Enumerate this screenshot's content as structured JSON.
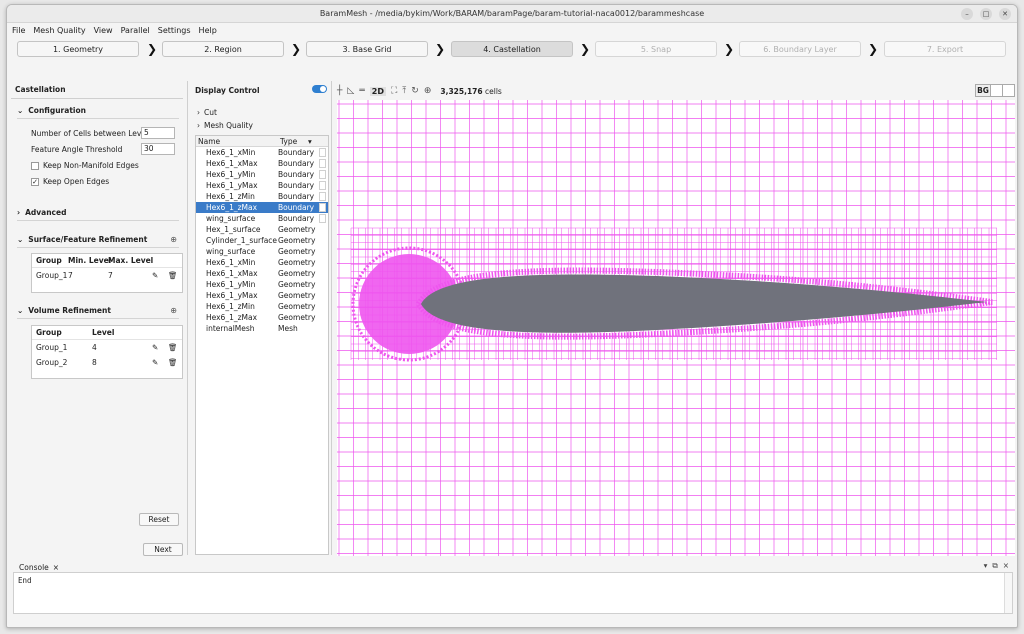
{
  "window": {
    "title": "BaramMesh - /media/bykim/Work/BARAM/baramPage/baram-tutorial-naca0012/barammeshcase"
  },
  "menu": [
    "File",
    "Mesh Quality",
    "View",
    "Parallel",
    "Settings",
    "Help"
  ],
  "steps": [
    {
      "label": "1. Geometry",
      "state": "normal"
    },
    {
      "label": "2. Region",
      "state": "normal"
    },
    {
      "label": "3. Base Grid",
      "state": "normal"
    },
    {
      "label": "4. Castellation",
      "state": "active"
    },
    {
      "label": "5. Snap",
      "state": "disabled"
    },
    {
      "label": "6. Boundary Layer",
      "state": "disabled"
    },
    {
      "label": "7. Export",
      "state": "disabled"
    }
  ],
  "castellation": {
    "title": "Castellation",
    "configuration": {
      "label": "Configuration",
      "cells_between_levels_label": "Number of Cells between Levels",
      "cells_between_levels": "5",
      "feature_angle_label": "Feature Angle Threshold",
      "feature_angle": "30",
      "keep_non_manifold_label": "Keep Non-Manifold Edges",
      "keep_non_manifold": false,
      "keep_open_edges_label": "Keep Open Edges",
      "keep_open_edges": true
    },
    "advanced_label": "Advanced",
    "surface_refinement": {
      "label": "Surface/Feature Refinement",
      "headers": [
        "Group",
        "Min. Level",
        "Max. Level"
      ],
      "rows": [
        {
          "group": "Group_1",
          "min": "7",
          "max": "7"
        }
      ]
    },
    "volume_refinement": {
      "label": "Volume Refinement",
      "headers": [
        "Group",
        "Level"
      ],
      "rows": [
        {
          "group": "Group_1",
          "level": "4"
        },
        {
          "group": "Group_2",
          "level": "8"
        }
      ]
    },
    "reset_label": "Reset",
    "next_label": "Next"
  },
  "display_control": {
    "title": "Display Control",
    "cut_label": "Cut",
    "mesh_quality_label": "Mesh Quality",
    "headers": {
      "name": "Name",
      "type": "Type"
    },
    "items": [
      {
        "name": "Hex6_1_xMin",
        "type": "Boundary",
        "selected": false
      },
      {
        "name": "Hex6_1_xMax",
        "type": "Boundary",
        "selected": false
      },
      {
        "name": "Hex6_1_yMin",
        "type": "Boundary",
        "selected": false
      },
      {
        "name": "Hex6_1_yMax",
        "type": "Boundary",
        "selected": false
      },
      {
        "name": "Hex6_1_zMin",
        "type": "Boundary",
        "selected": false
      },
      {
        "name": "Hex6_1_zMax",
        "type": "Boundary",
        "selected": true
      },
      {
        "name": "wing_surface",
        "type": "Boundary",
        "selected": false
      },
      {
        "name": "Hex_1_surface",
        "type": "Geometry",
        "selected": false
      },
      {
        "name": "Cylinder_1_surface",
        "type": "Geometry",
        "selected": false
      },
      {
        "name": "wing_surface",
        "type": "Geometry",
        "selected": false
      },
      {
        "name": "Hex6_1_xMin",
        "type": "Geometry",
        "selected": false
      },
      {
        "name": "Hex6_1_xMax",
        "type": "Geometry",
        "selected": false
      },
      {
        "name": "Hex6_1_yMin",
        "type": "Geometry",
        "selected": false
      },
      {
        "name": "Hex6_1_yMax",
        "type": "Geometry",
        "selected": false
      },
      {
        "name": "Hex6_1_zMin",
        "type": "Geometry",
        "selected": false
      },
      {
        "name": "Hex6_1_zMax",
        "type": "Geometry",
        "selected": false
      },
      {
        "name": "internalMesh",
        "type": "Mesh",
        "selected": false
      }
    ]
  },
  "viewer": {
    "mode_label": "2D",
    "cell_count": "3,325,176",
    "cell_unit": "cells",
    "bg_label": "BG",
    "mesh_color": "#ee55ee",
    "wing_color": "#70727c"
  },
  "console": {
    "tab_label": "Console",
    "text": "End"
  }
}
